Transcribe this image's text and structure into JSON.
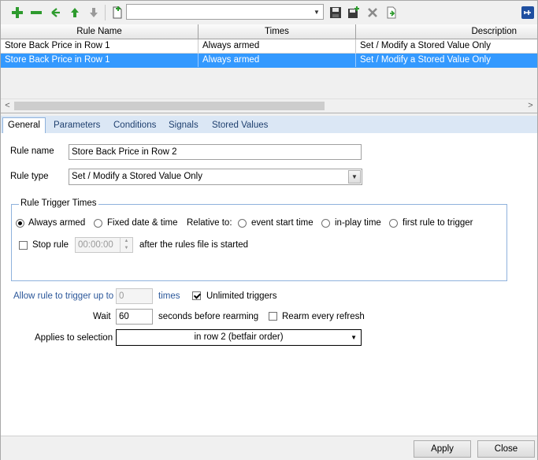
{
  "toolbar": {
    "buttons": [
      {
        "name": "add-rule-button",
        "icon": "plus-icon",
        "color": "#2e9b2e"
      },
      {
        "name": "remove-rule-button",
        "icon": "minus-icon",
        "color": "#2e9b2e"
      },
      {
        "name": "duplicate-rule-button",
        "icon": "branch-icon",
        "color": "#2e9b2e"
      },
      {
        "name": "move-up-button",
        "icon": "arrow-up-icon",
        "color": "#2e9b2e"
      },
      {
        "name": "move-down-button",
        "icon": "arrow-down-icon",
        "color": "#9a9a9a"
      },
      {
        "name": "new-file-button",
        "icon": "new-file-icon",
        "color": "#2e9b2e"
      }
    ],
    "file_combo_value": "",
    "right_buttons": [
      "save-icon",
      "save-as-icon",
      "delete-icon",
      "export-icon"
    ],
    "pin_icon": "pin-icon"
  },
  "grid": {
    "columns": [
      "Rule Name",
      "Times",
      "Description"
    ],
    "rows": [
      {
        "rule_name": "Store Back Price in Row 1",
        "times": "Always armed",
        "description": "Set / Modify a Stored Value Only",
        "selected": false
      },
      {
        "rule_name": "Store Back Price in Row 1",
        "times": "Always armed",
        "description": "Set / Modify a Stored Value Only",
        "selected": true
      }
    ],
    "scroll_left": "<",
    "scroll_right": ">"
  },
  "tabs": [
    {
      "label": "General",
      "active": true
    },
    {
      "label": "Parameters",
      "active": false
    },
    {
      "label": "Conditions",
      "active": false
    },
    {
      "label": "Signals",
      "active": false
    },
    {
      "label": "Stored Values",
      "active": false
    }
  ],
  "general": {
    "rule_name_label": "Rule name",
    "rule_name_value": "Store Back Price in Row 2",
    "rule_type_label": "Rule type",
    "rule_type_value": "Set / Modify a Stored Value Only",
    "trigger_group": {
      "title": "Rule Trigger Times",
      "always_armed": "Always armed",
      "fixed_date": "Fixed date & time",
      "relative_to": "Relative to:",
      "event_start": "event start time",
      "in_play": "in-play time",
      "first_rule": "first rule to trigger",
      "stop_rule": "Stop rule",
      "stop_time": "00:00:00",
      "after_started": "after the rules file is started"
    },
    "allow_label": "Allow rule to trigger up to",
    "allow_value": "0",
    "times_label": "times",
    "unlimited_label": "Unlimited triggers",
    "wait_label": "Wait",
    "wait_value": "60",
    "seconds_label": "seconds before rearming",
    "rearm_label": "Rearm every refresh",
    "applies_label": "Applies to selection",
    "applies_value": "in row 2 (betfair order)"
  },
  "buttons": {
    "apply": "Apply",
    "close": "Close"
  },
  "colors": {
    "selection": "#3399ff",
    "tab_strip": "#dbe7f5",
    "label_blue": "#2b579a"
  }
}
